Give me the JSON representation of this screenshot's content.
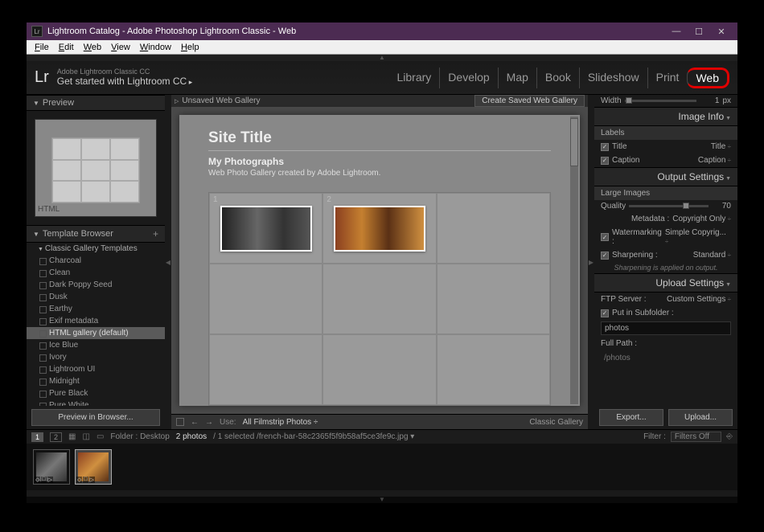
{
  "window": {
    "title": "Lightroom Catalog - Adobe Photoshop Lightroom Classic - Web",
    "icon_text": "Lr"
  },
  "menubar": [
    "File",
    "Edit",
    "Web",
    "View",
    "Window",
    "Help"
  ],
  "identity": {
    "logo": "Lr",
    "line1": "Adobe Lightroom Classic CC",
    "line2": "Get started with Lightroom CC"
  },
  "modules": [
    "Library",
    "Develop",
    "Map",
    "Book",
    "Slideshow",
    "Print",
    "Web"
  ],
  "active_module": "Web",
  "left": {
    "preview_title": "Preview",
    "preview_label": "HTML",
    "template_title": "Template Browser",
    "template_group": "Classic Gallery Templates",
    "templates": [
      "Charcoal",
      "Clean",
      "Dark Poppy Seed",
      "Dusk",
      "Earthy",
      "Exif metadata",
      "HTML gallery (default)",
      "Ice Blue",
      "Ivory",
      "Lightroom UI",
      "Midnight",
      "Pure Black",
      "Pure White"
    ],
    "selected_template": "HTML gallery (default)",
    "preview_btn": "Preview in Browser..."
  },
  "center": {
    "unsaved": "Unsaved Web Gallery",
    "save_btn": "Create Saved Web Gallery",
    "site_title": "Site Title",
    "collection_title": "My Photographs",
    "collection_desc": "Web Photo Gallery created by Adobe Lightroom.",
    "cell1_num": "1",
    "cell2_num": "2",
    "use_label": "Use:",
    "use_value": "All Filmstrip Photos",
    "style_name": "Classic Gallery"
  },
  "right": {
    "width_label": "Width",
    "width_val": "1",
    "width_unit": "px",
    "image_info": "Image Info",
    "labels": "Labels",
    "title_label": "Title",
    "title_val": "Title",
    "caption_label": "Caption",
    "caption_val": "Caption",
    "output_settings": "Output Settings",
    "large_images": "Large Images",
    "quality_label": "Quality",
    "quality_val": "70",
    "metadata_label": "Metadata :",
    "metadata_val": "Copyright Only",
    "watermark_label": "Watermarking :",
    "watermark_val": "Simple Copyrig...",
    "sharpen_label": "Sharpening :",
    "sharpen_val": "Standard",
    "sharpen_note": "Sharpening is applied on output.",
    "upload_settings": "Upload Settings",
    "ftp_label": "FTP Server :",
    "ftp_val": "Custom Settings",
    "subfolder_label": "Put in Subfolder :",
    "subfolder_val": "photos",
    "fullpath_label": "Full Path :",
    "fullpath_val": "/photos",
    "export_btn": "Export...",
    "upload_btn": "Upload..."
  },
  "secondary": {
    "page1": "1",
    "page2": "2",
    "folder": "Folder : Desktop",
    "count": "2 photos",
    "selected": "/ 1 selected  /french-bar-58c2365f5f9b58af5ce3fe9c.jpg ▾",
    "filter_label": "Filter :",
    "filter_val": "Filters Off"
  }
}
